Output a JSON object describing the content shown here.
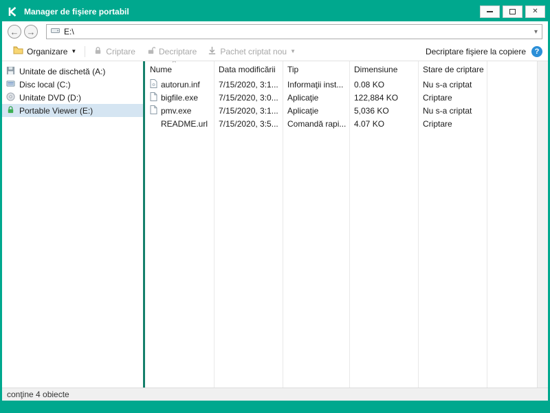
{
  "window": {
    "title": "Manager de fişiere portabil"
  },
  "nav": {
    "address": "E:\\"
  },
  "toolbar": {
    "organize_label": "Organizare",
    "encrypt_label": "Criptare",
    "decrypt_label": "Decriptare",
    "new_package_label": "Pachet criptat nou",
    "decrypt_on_copy_label": "Decriptare fişiere la copiere"
  },
  "sidebar": {
    "items": [
      {
        "label": "Unitate de dischetă (A:)",
        "icon": "floppy-icon",
        "selected": false
      },
      {
        "label": "Disc local (C:)",
        "icon": "hard-disk-icon",
        "selected": false
      },
      {
        "label": "Unitate DVD (D:)",
        "icon": "dvd-icon",
        "selected": false
      },
      {
        "label": "Portable Viewer (E:)",
        "icon": "green-lock-icon",
        "selected": true
      }
    ]
  },
  "files": {
    "columns": [
      "Nume",
      "Data modificării",
      "Tip",
      "Dimensiune",
      "Stare de criptare"
    ],
    "sort": {
      "column": "Nume",
      "direction": "asc",
      "indicator": "^"
    },
    "rows": [
      {
        "name": "autorun.inf",
        "modified": "7/15/2020, 3:1...",
        "type": "Informaţii inst...",
        "size": "0.08 KO",
        "encryption": "Nu s-a criptat"
      },
      {
        "name": "bigfile.exe",
        "modified": "7/15/2020, 3:0...",
        "type": "Aplicaţie",
        "size": "122,884 KO",
        "encryption": "Criptare"
      },
      {
        "name": "pmv.exe",
        "modified": "7/15/2020, 3:1...",
        "type": "Aplicaţie",
        "size": "5,036 KO",
        "encryption": "Nu s-a criptat"
      },
      {
        "name": "README.url",
        "modified": "7/15/2020, 3:5...",
        "type": "Comandă rapi...",
        "size": "4.07 KO",
        "encryption": "Criptare"
      }
    ]
  },
  "statusbar": {
    "text": "conţine 4 obiecte"
  },
  "colors": {
    "brand": "#00a88e",
    "selection": "#d5e5f2",
    "help_blue": "#2b8fd8",
    "divider_teal": "#15806b"
  }
}
